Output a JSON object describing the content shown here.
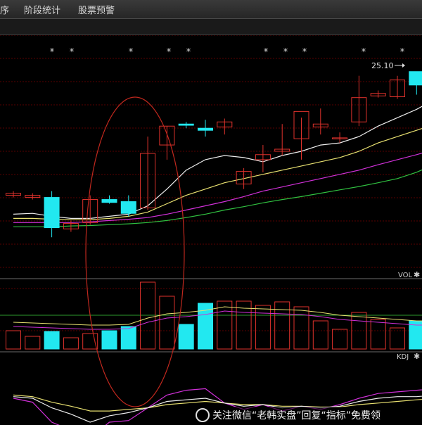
{
  "menu": {
    "items": [
      "序",
      "阶段统计",
      "股票预警"
    ]
  },
  "price_panel": {
    "last_price_label": "25.10",
    "markers": [
      "*",
      "*",
      "*",
      "*",
      "*",
      "*",
      "*",
      "*",
      "*",
      "*"
    ]
  },
  "vol_panel": {
    "label": "VOL"
  },
  "kdj_panel": {
    "label": "KDJ"
  },
  "watermark": {
    "text": "关注微信“老韩实盘”回复“指标”免费领"
  },
  "colors": {
    "up": "#e0322c",
    "down": "#22e8f0",
    "ma_white": "#ececec",
    "ma_yellow": "#e8e070",
    "ma_magenta": "#d030d8",
    "ma_green": "#30c040",
    "grid": "#5a0000",
    "highlight_ellipse": "#c0281e"
  },
  "chart_data": {
    "type": "candlestick",
    "candles": [
      {
        "o": 22.15,
        "h": 22.25,
        "l": 22.1,
        "c": 22.2
      },
      {
        "o": 22.1,
        "h": 22.2,
        "l": 22.05,
        "c": 22.15
      },
      {
        "o": 22.1,
        "h": 22.25,
        "l": 21.15,
        "c": 21.38
      },
      {
        "o": 21.35,
        "h": 21.55,
        "l": 21.28,
        "c": 21.48
      },
      {
        "o": 21.5,
        "h": 22.15,
        "l": 21.45,
        "c": 22.05
      },
      {
        "o": 22.05,
        "h": 22.15,
        "l": 21.95,
        "c": 21.98
      },
      {
        "o": 22.0,
        "h": 22.15,
        "l": 21.65,
        "c": 21.72
      },
      {
        "o": 21.85,
        "h": 23.55,
        "l": 21.8,
        "c": 23.15
      },
      {
        "o": 23.35,
        "h": 23.8,
        "l": 23.0,
        "c": 23.8
      },
      {
        "o": 23.85,
        "h": 23.9,
        "l": 23.75,
        "c": 23.82
      },
      {
        "o": 23.75,
        "h": 23.95,
        "l": 23.55,
        "c": 23.7
      },
      {
        "o": 23.78,
        "h": 23.98,
        "l": 23.6,
        "c": 23.9
      },
      {
        "o": 22.42,
        "h": 22.8,
        "l": 22.3,
        "c": 22.72
      },
      {
        "o": 23.0,
        "h": 23.35,
        "l": 22.7,
        "c": 23.12
      },
      {
        "o": 23.2,
        "h": 23.85,
        "l": 23.1,
        "c": 23.25
      },
      {
        "o": 23.5,
        "h": 24.0,
        "l": 23.0,
        "c": 24.15
      },
      {
        "o": 23.78,
        "h": 24.22,
        "l": 23.6,
        "c": 23.85
      },
      {
        "o": 23.5,
        "h": 23.65,
        "l": 23.4,
        "c": 23.52
      },
      {
        "o": 23.9,
        "h": 25.0,
        "l": 23.8,
        "c": 24.48
      },
      {
        "o": 24.52,
        "h": 24.65,
        "l": 24.48,
        "c": 24.58
      },
      {
        "o": 24.5,
        "h": 25.0,
        "l": 24.45,
        "c": 24.9
      },
      {
        "o": 25.1,
        "h": 25.1,
        "l": 24.55,
        "c": 24.78
      },
      {
        "o": 24.8,
        "h": 25.1,
        "l": 24.7,
        "c": 25.05
      }
    ],
    "volume": [
      26,
      18,
      25,
      16,
      22,
      26,
      32,
      95,
      75,
      35,
      65,
      68,
      68,
      62,
      67,
      60,
      40,
      28,
      52,
      42,
      30,
      40,
      42
    ],
    "ma_white": [
      21.7,
      21.72,
      21.65,
      21.6,
      21.6,
      21.65,
      21.7,
      21.9,
      22.3,
      22.75,
      23.0,
      23.1,
      23.05,
      22.95,
      23.1,
      23.2,
      23.35,
      23.4,
      23.55,
      23.8,
      24.0,
      24.2,
      24.45
    ],
    "ma_yellow": [
      21.6,
      21.6,
      21.58,
      21.57,
      21.57,
      21.6,
      21.65,
      21.75,
      21.95,
      22.15,
      22.3,
      22.45,
      22.55,
      22.65,
      22.75,
      22.85,
      22.95,
      23.05,
      23.2,
      23.4,
      23.55,
      23.7,
      23.85
    ],
    "ma_magenta": [
      21.5,
      21.5,
      21.5,
      21.5,
      21.52,
      21.55,
      21.58,
      21.62,
      21.7,
      21.8,
      21.9,
      22.0,
      22.12,
      22.25,
      22.35,
      22.45,
      22.55,
      22.65,
      22.75,
      22.88,
      23.0,
      23.12,
      23.25
    ],
    "ma_green": [
      21.4,
      21.4,
      21.4,
      21.42,
      21.43,
      21.45,
      21.47,
      21.5,
      21.55,
      21.62,
      21.7,
      21.8,
      21.88,
      21.97,
      22.05,
      22.12,
      22.2,
      22.28,
      22.36,
      22.45,
      22.55,
      22.7,
      22.9
    ],
    "vol_ma": [
      38,
      37,
      36,
      35,
      34,
      34,
      35,
      44,
      50,
      52,
      55,
      60,
      58,
      57,
      56,
      55,
      52,
      48,
      46,
      44,
      42,
      40,
      40
    ],
    "kdj_k": [
      62,
      60,
      48,
      40,
      30,
      38,
      42,
      48,
      56,
      58,
      60,
      54,
      50,
      52,
      48,
      50,
      48,
      50,
      56,
      60,
      62,
      62,
      64
    ],
    "kdj_d": [
      64,
      62,
      55,
      50,
      44,
      44,
      46,
      48,
      52,
      54,
      56,
      54,
      52,
      52,
      50,
      50,
      49,
      49,
      52,
      54,
      56,
      58,
      60
    ],
    "kdj_j": [
      60,
      55,
      30,
      20,
      10,
      30,
      32,
      48,
      64,
      70,
      72,
      54,
      46,
      52,
      44,
      50,
      46,
      52,
      60,
      66,
      68,
      70,
      72
    ],
    "ylim": [
      20.6,
      25.8
    ]
  }
}
